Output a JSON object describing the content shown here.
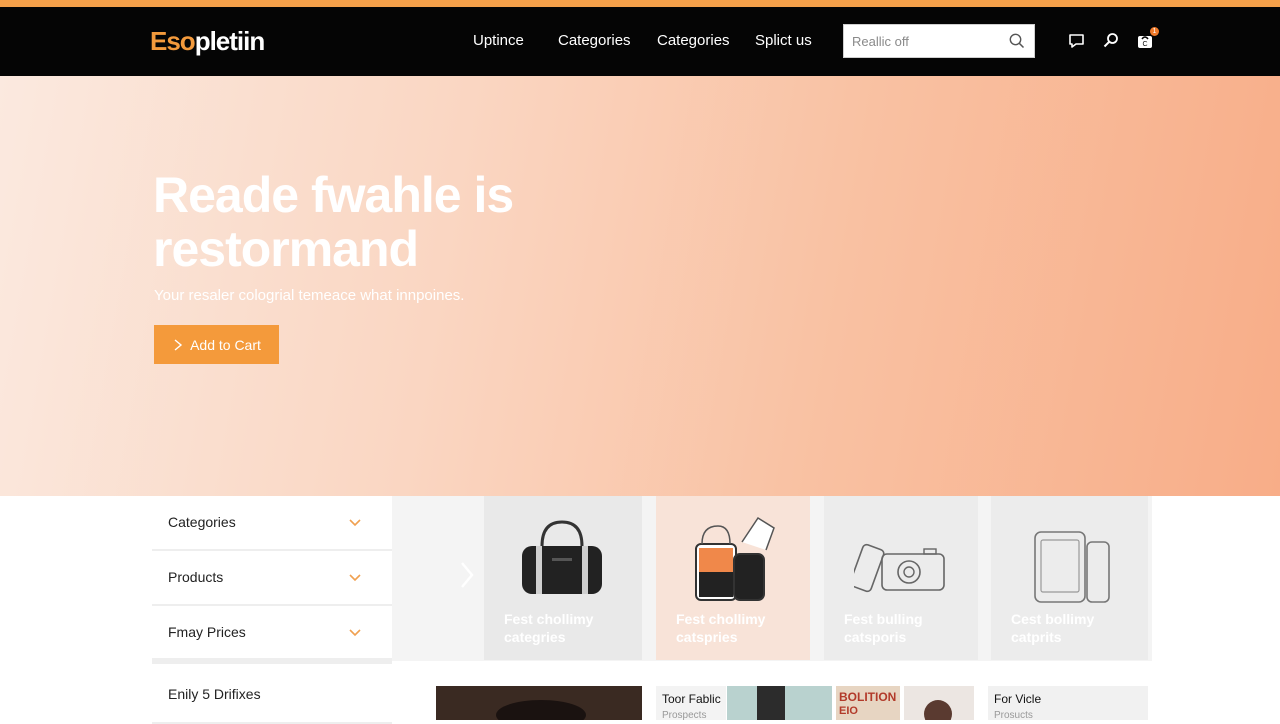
{
  "brand": {
    "logo_accent": "Eso",
    "logo_rest": "pletiin"
  },
  "nav": {
    "links": [
      "Uptince",
      "Categories",
      "Categories",
      "Splict us"
    ],
    "search_placeholder": "Reallic off",
    "cart_count": "1"
  },
  "hero": {
    "title_line1": "Reade fwahle is",
    "title_line2": "restormand",
    "subtitle": "Your resaler cologrial temeace what innpoines.",
    "cta_label": "Add to Cart"
  },
  "sidebar": {
    "items": [
      {
        "label": "Categories"
      },
      {
        "label": "Products"
      },
      {
        "label": "Fmay Prices"
      },
      {
        "label": "Enily 5 Drifixes"
      }
    ]
  },
  "categories": [
    {
      "caption": "Fest chollimy categries",
      "icon": "handbag-icon"
    },
    {
      "caption": "Fest chollimy catspries",
      "icon": "accessories-icon"
    },
    {
      "caption": "Fest bulling catsporis",
      "icon": "camera-icon"
    },
    {
      "caption": "Cest bollimy catprits",
      "icon": "devices-icon"
    }
  ],
  "thumbs": [
    {
      "title": "",
      "sub": ""
    },
    {
      "title": "Toor Fablic",
      "sub": "Prospects"
    },
    {
      "title": "",
      "sub": ""
    },
    {
      "title": "BOLITION",
      "sub": "EIO"
    },
    {
      "title": "",
      "sub": ""
    },
    {
      "title": "For Vicle",
      "sub": "Prosucts"
    }
  ],
  "colors": {
    "accent": "#f49a3b",
    "navbar": "#050505"
  }
}
